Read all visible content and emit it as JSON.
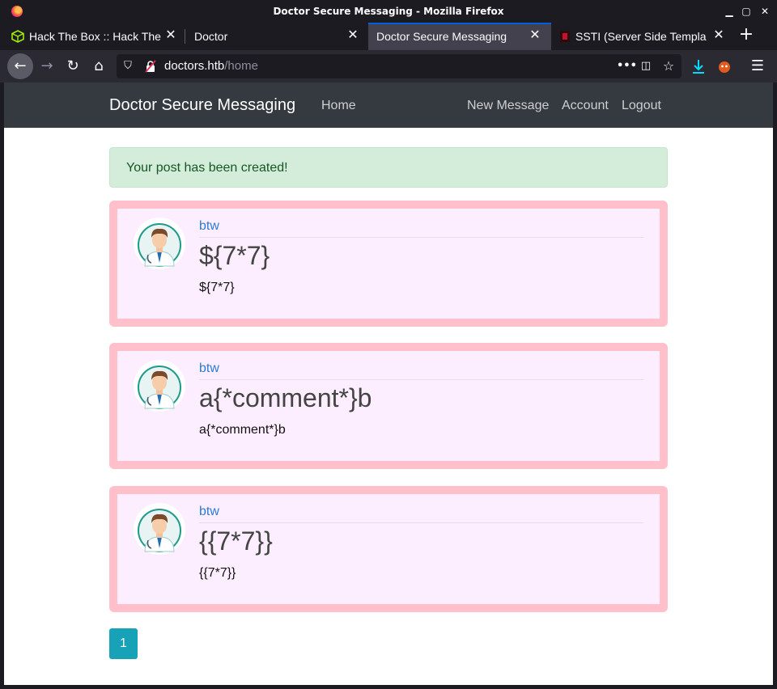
{
  "window": {
    "title": "Doctor Secure Messaging - Mozilla Firefox"
  },
  "tabs": [
    {
      "label": "Hack The Box :: Hack The",
      "active": false,
      "icon": "htb-cube-icon"
    },
    {
      "label": "Doctor",
      "active": false,
      "icon": ""
    },
    {
      "label": "Doctor Secure Messaging",
      "active": true,
      "icon": ""
    },
    {
      "label": "SSTI (Server Side Templa",
      "active": false,
      "icon": "hacktricks-icon"
    }
  ],
  "urlbar": {
    "host": "doctors.htb",
    "path": "/home"
  },
  "site": {
    "brand": "Doctor Secure Messaging",
    "nav_home": "Home",
    "nav_new_message": "New Message",
    "nav_account": "Account",
    "nav_logout": "Logout"
  },
  "alert": {
    "message": "Your post has been created!"
  },
  "posts": [
    {
      "author": "btw",
      "title": "${7*7}",
      "content": "${7*7}"
    },
    {
      "author": "btw",
      "title": "a{*comment*}b",
      "content": "a{*comment*}b"
    },
    {
      "author": "btw",
      "title": "{{7*7}}",
      "content": "{{7*7}}"
    }
  ],
  "pagination": {
    "current": "1"
  },
  "colors": {
    "post_border": "#ffc0cb",
    "post_bg": "#fdeeff",
    "alert_bg": "#d4edda",
    "pager": "#17a2b8",
    "author_link": "#2b7bd4"
  }
}
